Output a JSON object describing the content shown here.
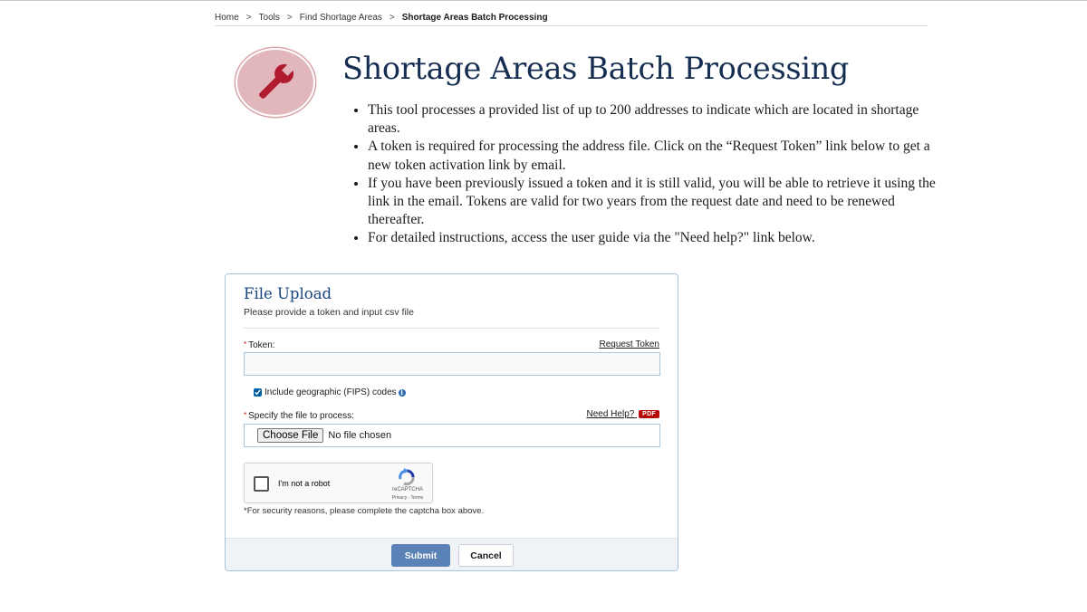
{
  "breadcrumb": {
    "items": [
      "Home",
      "Tools",
      "Find Shortage Areas"
    ],
    "current": "Shortage Areas Batch Processing",
    "separator": ">"
  },
  "hero": {
    "icon": "wrench-icon",
    "icon_color": "#b01c2e",
    "circle_color": "#e2b7bb"
  },
  "title": "Shortage Areas Batch Processing",
  "bullets": [
    "This tool processes a provided list of up to 200 addresses to indicate which are located in shortage areas.",
    "A token is required for processing the address file. Click on the “Request Token” link below to get a new token activation link by email.",
    "If you have been previously issued a token and it is still valid, you will be able to retrieve it using the link in the email. Tokens are valid for two years from the request date and need to be renewed thereafter.",
    "For detailed instructions, access the user guide via the \"Need help?\" link below."
  ],
  "form": {
    "title": "File Upload",
    "subtitle": "Please provide a token and input csv file",
    "required_marker": "*",
    "token_label": "Token:",
    "request_token_link": "Request Token",
    "token_value": "",
    "fips_label": "Include geographic (FIPS) codes",
    "fips_checked": true,
    "file_label": "Specify the file to process:",
    "need_help_link": "Need Help?",
    "pdf_badge": "PDF",
    "choose_file_button": "Choose File",
    "no_file_text": "No file chosen",
    "captcha": {
      "label": "I'm not a robot",
      "brand": "reCAPTCHA",
      "links": "Privacy - Terms"
    },
    "security_note": "*For security reasons, please complete the captcha box above.",
    "submit_label": "Submit",
    "cancel_label": "Cancel"
  },
  "colors": {
    "title": "#162e51",
    "card_title": "#1a4480",
    "submit_bg": "#5b82b6",
    "required": "#b50909",
    "pdf_badge": "#b50909"
  }
}
